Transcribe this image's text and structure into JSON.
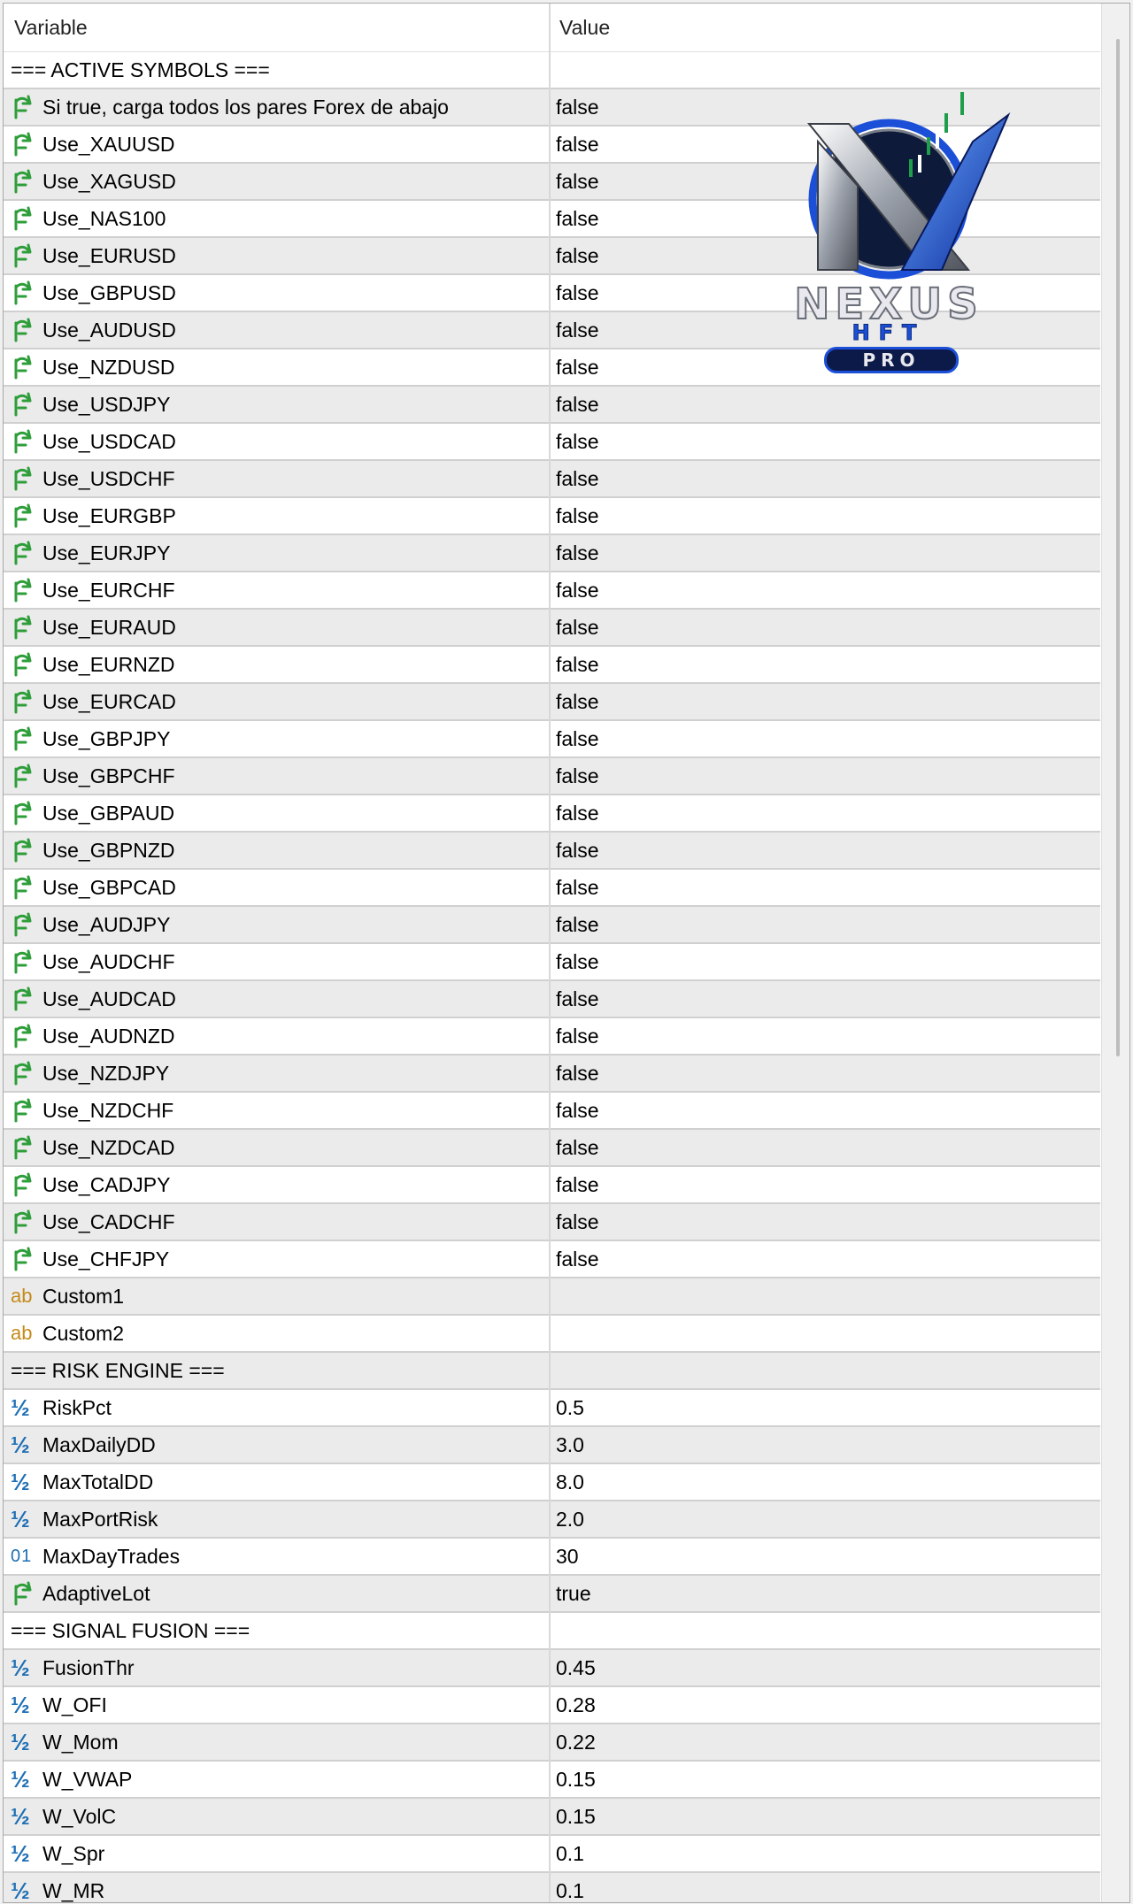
{
  "header": {
    "variable_label": "Variable",
    "value_label": "Value"
  },
  "rows": [
    {
      "type": "section",
      "name": "=== ACTIVE SYMBOLS ===",
      "value": ""
    },
    {
      "type": "bool",
      "name": "Si true, carga todos los pares Forex de abajo",
      "value": "false"
    },
    {
      "type": "bool",
      "name": "Use_XAUUSD",
      "value": "false"
    },
    {
      "type": "bool",
      "name": "Use_XAGUSD",
      "value": "false"
    },
    {
      "type": "bool",
      "name": "Use_NAS100",
      "value": "false"
    },
    {
      "type": "bool",
      "name": "Use_EURUSD",
      "value": "false"
    },
    {
      "type": "bool",
      "name": "Use_GBPUSD",
      "value": "false"
    },
    {
      "type": "bool",
      "name": "Use_AUDUSD",
      "value": "false"
    },
    {
      "type": "bool",
      "name": "Use_NZDUSD",
      "value": "false"
    },
    {
      "type": "bool",
      "name": "Use_USDJPY",
      "value": "false"
    },
    {
      "type": "bool",
      "name": "Use_USDCAD",
      "value": "false"
    },
    {
      "type": "bool",
      "name": "Use_USDCHF",
      "value": "false"
    },
    {
      "type": "bool",
      "name": "Use_EURGBP",
      "value": "false"
    },
    {
      "type": "bool",
      "name": "Use_EURJPY",
      "value": "false"
    },
    {
      "type": "bool",
      "name": "Use_EURCHF",
      "value": "false"
    },
    {
      "type": "bool",
      "name": "Use_EURAUD",
      "value": "false"
    },
    {
      "type": "bool",
      "name": "Use_EURNZD",
      "value": "false"
    },
    {
      "type": "bool",
      "name": "Use_EURCAD",
      "value": "false"
    },
    {
      "type": "bool",
      "name": "Use_GBPJPY",
      "value": "false"
    },
    {
      "type": "bool",
      "name": "Use_GBPCHF",
      "value": "false"
    },
    {
      "type": "bool",
      "name": "Use_GBPAUD",
      "value": "false"
    },
    {
      "type": "bool",
      "name": "Use_GBPNZD",
      "value": "false"
    },
    {
      "type": "bool",
      "name": "Use_GBPCAD",
      "value": "false"
    },
    {
      "type": "bool",
      "name": "Use_AUDJPY",
      "value": "false"
    },
    {
      "type": "bool",
      "name": "Use_AUDCHF",
      "value": "false"
    },
    {
      "type": "bool",
      "name": "Use_AUDCAD",
      "value": "false"
    },
    {
      "type": "bool",
      "name": "Use_AUDNZD",
      "value": "false"
    },
    {
      "type": "bool",
      "name": "Use_NZDJPY",
      "value": "false"
    },
    {
      "type": "bool",
      "name": "Use_NZDCHF",
      "value": "false"
    },
    {
      "type": "bool",
      "name": "Use_NZDCAD",
      "value": "false"
    },
    {
      "type": "bool",
      "name": "Use_CADJPY",
      "value": "false"
    },
    {
      "type": "bool",
      "name": "Use_CADCHF",
      "value": "false"
    },
    {
      "type": "bool",
      "name": "Use_CHFJPY",
      "value": "false"
    },
    {
      "type": "string",
      "name": "Custom1",
      "value": ""
    },
    {
      "type": "string",
      "name": "Custom2",
      "value": ""
    },
    {
      "type": "section",
      "name": "=== RISK ENGINE ===",
      "value": ""
    },
    {
      "type": "double",
      "name": "RiskPct",
      "value": "0.5"
    },
    {
      "type": "double",
      "name": "MaxDailyDD",
      "value": "3.0"
    },
    {
      "type": "double",
      "name": "MaxTotalDD",
      "value": "8.0"
    },
    {
      "type": "double",
      "name": "MaxPortRisk",
      "value": "2.0"
    },
    {
      "type": "int",
      "name": "MaxDayTrades",
      "value": "30"
    },
    {
      "type": "bool",
      "name": "AdaptiveLot",
      "value": "true"
    },
    {
      "type": "section",
      "name": "=== SIGNAL FUSION ===",
      "value": ""
    },
    {
      "type": "double",
      "name": "FusionThr",
      "value": "0.45"
    },
    {
      "type": "double",
      "name": "W_OFI",
      "value": "0.28"
    },
    {
      "type": "double",
      "name": "W_Mom",
      "value": "0.22"
    },
    {
      "type": "double",
      "name": "W_VWAP",
      "value": "0.15"
    },
    {
      "type": "double",
      "name": "W_VolC",
      "value": "0.15"
    },
    {
      "type": "double",
      "name": "W_Spr",
      "value": "0.1"
    },
    {
      "type": "double",
      "name": "W_MR",
      "value": "0.1"
    }
  ],
  "type_icons": {
    "bool": "bool-arrow-icon",
    "string": "ab-string-icon",
    "double": "half-double-icon",
    "int": "01-integer-icon"
  },
  "type_glyphs": {
    "string": "ab",
    "double": "½",
    "int": "01"
  },
  "logo": {
    "brand": "NEXUS",
    "sub": "HFT",
    "tag": "PRO"
  },
  "colors": {
    "row_alt": "#ebebeb",
    "bool_icon": "#2e9e3a",
    "string_icon": "#c48a1a",
    "numeric_icon": "#1e6fb5",
    "logo_blue": "#1b4fd8"
  }
}
